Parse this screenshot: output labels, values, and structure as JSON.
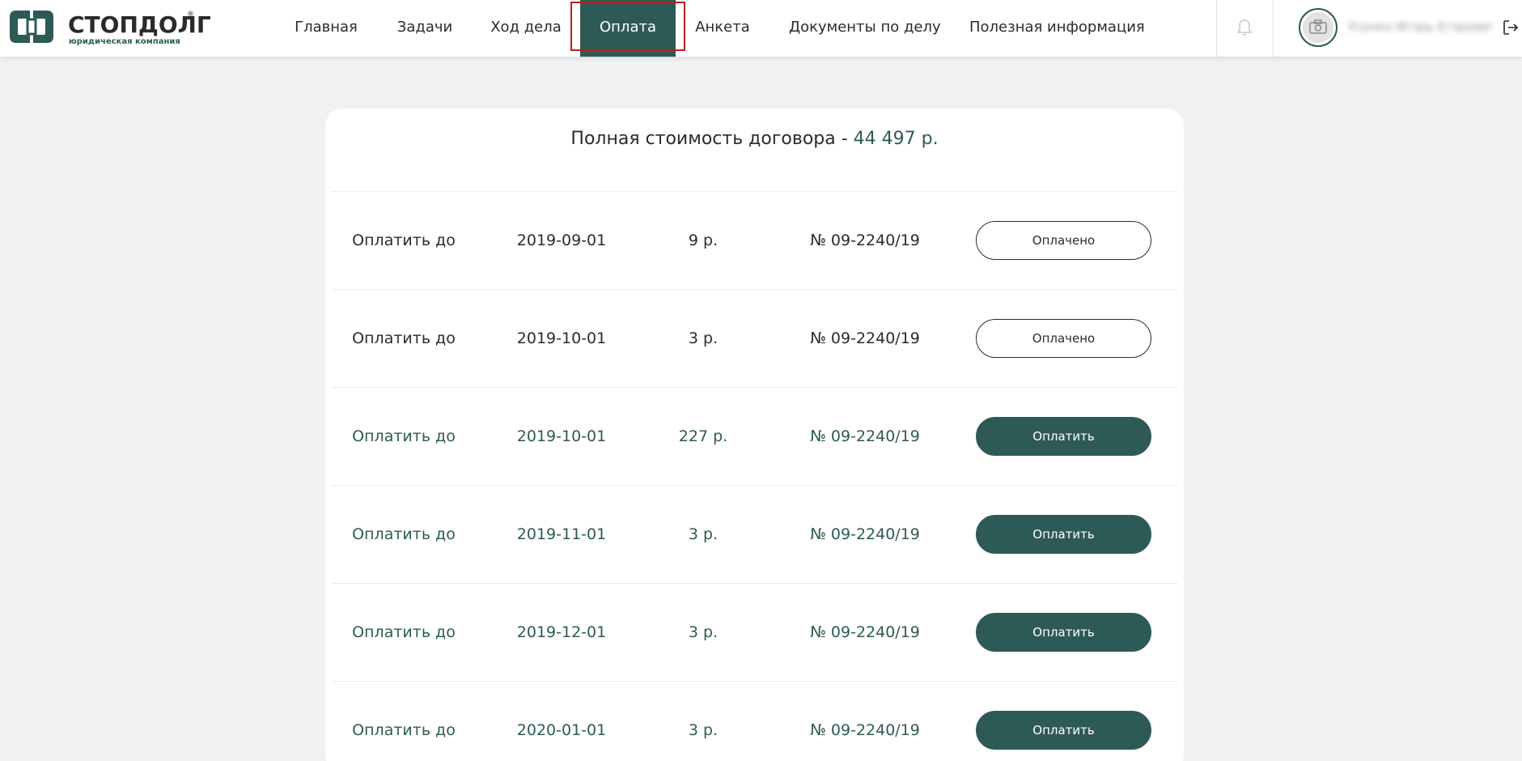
{
  "brand": {
    "name": "СТОПДОЛГ",
    "registered_mark": "®",
    "tagline": "юридическая компания",
    "accent_color": "#2e5a55",
    "logo_icon": "stopdolg-logo-icon"
  },
  "nav": {
    "items": [
      {
        "label": "Главная",
        "active": false
      },
      {
        "label": "Задачи",
        "active": false
      },
      {
        "label": "Ход дела",
        "active": false
      },
      {
        "label": "Оплата",
        "active": true
      },
      {
        "label": "Анкета",
        "active": false
      },
      {
        "label": "Документы по делу",
        "active": false
      },
      {
        "label": "Полезная информация",
        "active": false
      }
    ]
  },
  "user": {
    "name": "Усенко Игорь Егорович",
    "avatar_icon": "camera-icon",
    "notifications_icon": "bell-icon",
    "logout_icon": "logout-icon"
  },
  "summary": {
    "label": "Полная стоимость договора - ",
    "amount": "44 497 р."
  },
  "payments": [
    {
      "label": "Оплатить до",
      "date": "2019-09-01",
      "amount": "9 р.",
      "contract": "№ 09-2240/19",
      "button": "Оплачено",
      "status": "paid"
    },
    {
      "label": "Оплатить до",
      "date": "2019-10-01",
      "amount": "3 р.",
      "contract": "№ 09-2240/19",
      "button": "Оплачено",
      "status": "paid"
    },
    {
      "label": "Оплатить до",
      "date": "2019-10-01",
      "amount": "227 р.",
      "contract": "№ 09-2240/19",
      "button": "Оплатить",
      "status": "due"
    },
    {
      "label": "Оплатить до",
      "date": "2019-11-01",
      "amount": "3 р.",
      "contract": "№ 09-2240/19",
      "button": "Оплатить",
      "status": "due"
    },
    {
      "label": "Оплатить до",
      "date": "2019-12-01",
      "amount": "3 р.",
      "contract": "№ 09-2240/19",
      "button": "Оплатить",
      "status": "due"
    },
    {
      "label": "Оплатить до",
      "date": "2020-01-01",
      "amount": "3 р.",
      "contract": "№ 09-2240/19",
      "button": "Оплатить",
      "status": "due"
    }
  ]
}
